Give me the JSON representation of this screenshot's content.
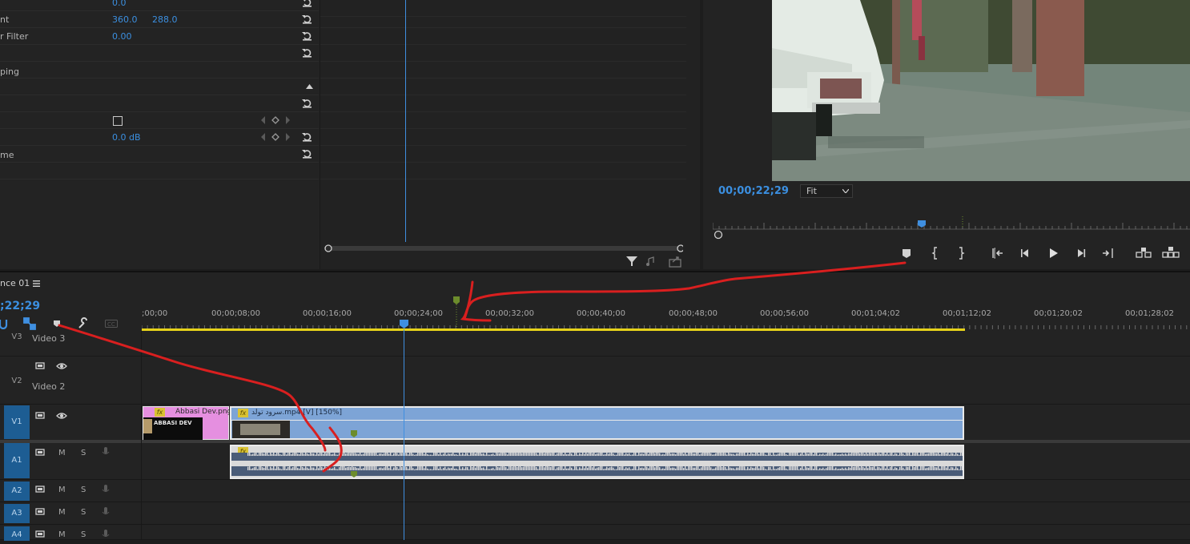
{
  "effect_controls": {
    "rows": [
      {
        "label": "",
        "values": [
          "0.0"
        ]
      },
      {
        "label": "nt",
        "values": [
          "360.0",
          "288.0"
        ]
      },
      {
        "label": "r Filter",
        "values": [
          "0.00"
        ]
      },
      {
        "label": "",
        "values": []
      },
      {
        "label": "ping",
        "values": []
      },
      {
        "label": "",
        "values": []
      },
      {
        "label": "",
        "values": []
      },
      {
        "label": "",
        "values": []
      },
      {
        "label": "",
        "values": [
          "0.0 dB"
        ]
      },
      {
        "label": "me",
        "values": []
      }
    ]
  },
  "program_monitor": {
    "timecode": "00;00;22;29",
    "zoom": "Fit",
    "controls": [
      "add-marker",
      "mark-in",
      "mark-out",
      "go-to-in",
      "step-back",
      "play",
      "step-forward",
      "go-to-out",
      "lift",
      "extract"
    ]
  },
  "timeline": {
    "sequence_tab": "nce 01",
    "timecode": ";22;29",
    "ruler_labels": [
      ";00;00",
      "00;00;08;00",
      "00;00;16;00",
      "00;00;24;00",
      "00;00;32;00",
      "00;00;40;00",
      "00;00;48;00",
      "00;00;56;00",
      "00;01;04;02",
      "00;01;12;02",
      "00;01;20;02",
      "00;01;28;02"
    ],
    "tracks": {
      "v3": {
        "id": "V3",
        "name": "Video 3"
      },
      "v2": {
        "id": "V2",
        "name": "Video 2"
      },
      "v1": {
        "id": "V1",
        "name": ""
      },
      "a1": {
        "id": "A1",
        "m": "M",
        "s": "S"
      },
      "a2": {
        "id": "A2",
        "m": "M",
        "s": "S"
      },
      "a3": {
        "id": "A3",
        "m": "M",
        "s": "S"
      },
      "a4": {
        "id": "A4",
        "m": "M",
        "s": "S"
      }
    },
    "clips": {
      "image_clip": {
        "fx": "fx",
        "name": "Abbasi Dev.png",
        "thumb_text": "ABBASI DEV"
      },
      "video_clip": {
        "fx": "fx",
        "name": "سرود تولد.mp4 [V] [150%]"
      },
      "audio_clip": {
        "fx": "fx"
      }
    }
  },
  "colors": {
    "accent_blue": "#3b8fe0",
    "work_area": "#e6d21a",
    "video_clip": "#7da4d6",
    "image_clip": "#e58fe0",
    "audio_clip": "#dadada",
    "marker": "#6c8c2c",
    "annotation": "#e02020"
  }
}
